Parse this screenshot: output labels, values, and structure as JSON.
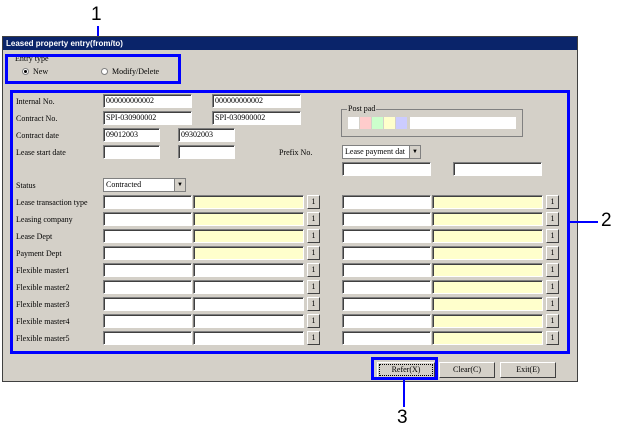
{
  "callouts": {
    "c1": "1",
    "c2": "2",
    "c3": "3"
  },
  "window": {
    "title": "Leased property entry(from/to)"
  },
  "entry_type": {
    "legend": "Entry type",
    "new_label": "New",
    "modify_label": "Modify/Delete",
    "selected": "New"
  },
  "labels": {
    "internal_no": "Internal No.",
    "contract_no": "Contract No.",
    "contract_date": "Contract date",
    "lease_start_date": "Lease start date",
    "status": "Status",
    "prefix_no": "Prefix No.",
    "post_pad": "Post pad",
    "lease_transaction_type": "Lease transaction type",
    "leasing_company": "Leasing company",
    "lease_dept": "Lease Dept",
    "payment_dept": "Payment Dept",
    "flexible_master1": "Flexible master1",
    "flexible_master2": "Flexible master2",
    "flexible_master3": "Flexible master3",
    "flexible_master4": "Flexible master4",
    "flexible_master5": "Flexible master5"
  },
  "values": {
    "internal_no_from": "000000000002",
    "internal_no_to": "000000000002",
    "contract_no_from": "SPI-030900002",
    "contract_no_to": "SPI-030900002",
    "contract_date_from": "09012003",
    "contract_date_to": "09302003",
    "status": "Contracted",
    "prefix_select": "Lease payment dat"
  },
  "lookup_label": "1",
  "buttons": {
    "refer": "Refer(X)",
    "clear": "Clear(C)",
    "exit": "Exit(E)"
  },
  "colors": {
    "callout": "#0000ff",
    "titlebar": "#0a246a",
    "highlight_field": "#ffffcc",
    "post_pad_swatches": [
      "#ffffff",
      "#ffcccc",
      "#ccffcc",
      "#ffffcc",
      "#ccccff"
    ]
  }
}
